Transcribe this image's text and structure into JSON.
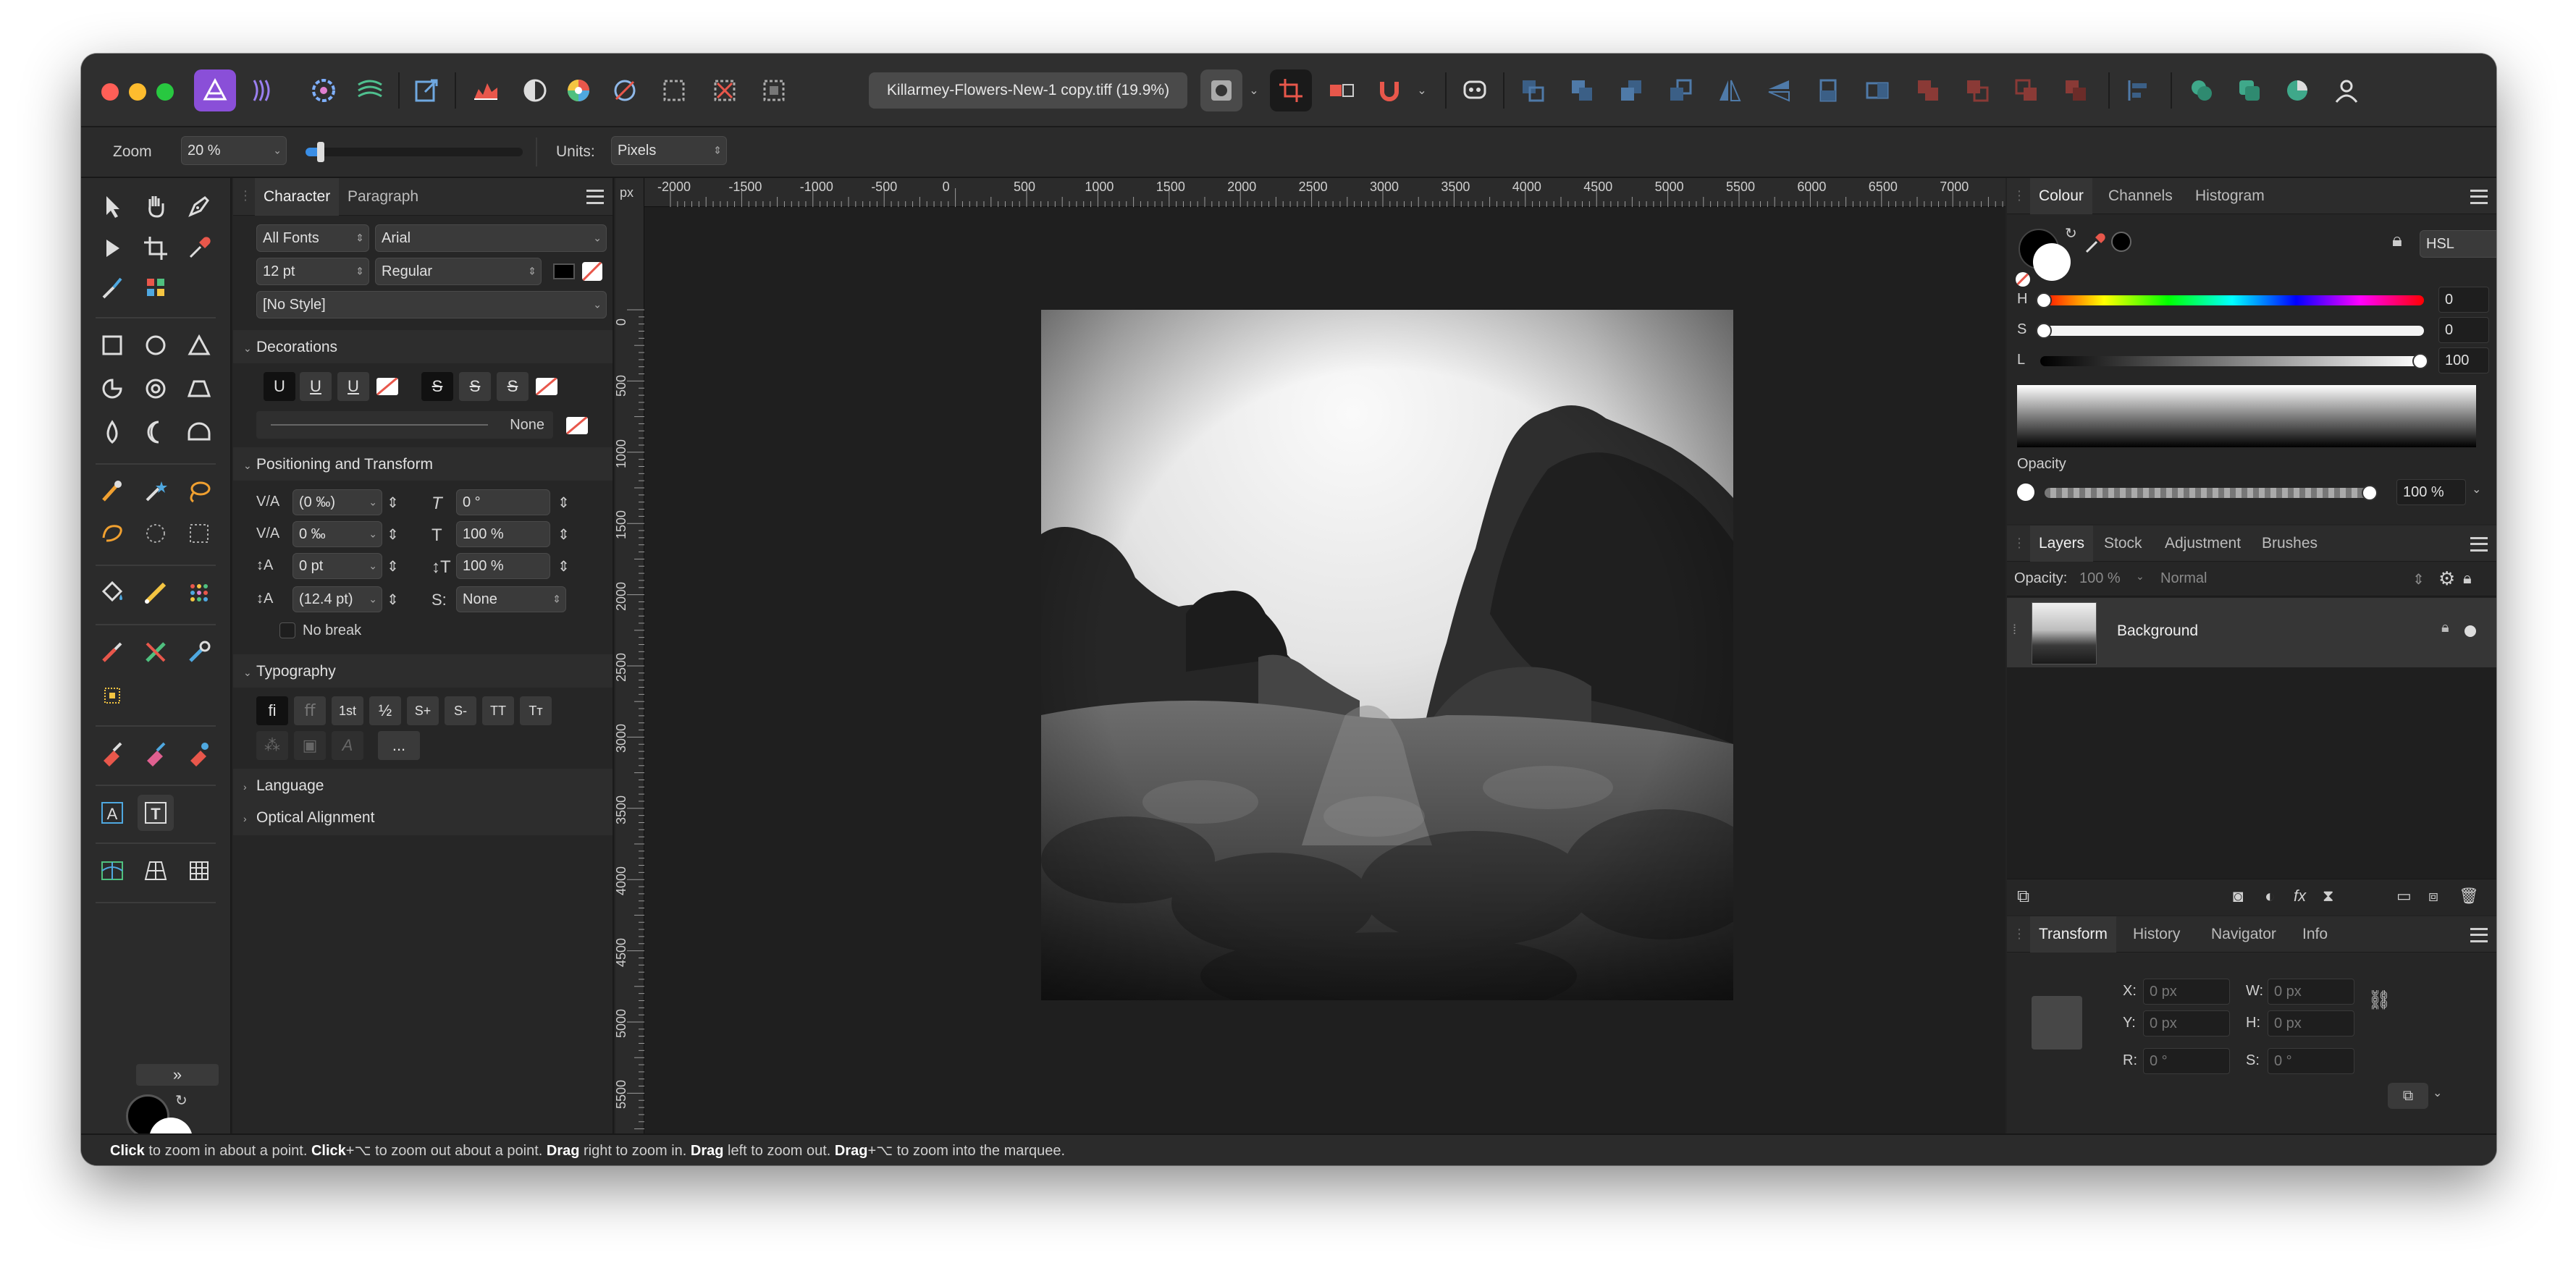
{
  "document": {
    "title": "Killarmey-Flowers-New-1 copy.tiff (19.9%)"
  },
  "context_toolbar": {
    "zoom_label": "Zoom",
    "zoom_value": "20 %",
    "units_label": "Units:",
    "units_value": "Pixels"
  },
  "character_panel": {
    "tabs": [
      "Character",
      "Paragraph"
    ],
    "font_collection": "All Fonts",
    "font_family": "Arial",
    "font_size": "12 pt",
    "font_style": "Regular",
    "paragraph_style": "[No Style]",
    "sections": {
      "decorations": "Decorations",
      "positioning": "Positioning and Transform",
      "typography": "Typography",
      "language": "Language",
      "optical": "Optical Alignment"
    },
    "decorations_line_value": "None",
    "positioning": {
      "kerning": "(0 ‰)",
      "tracking": "0 ‰",
      "baseline": "0 pt",
      "leading": "(12.4 pt)",
      "shear": "0 °",
      "horizontal_scale": "100 %",
      "vertical_scale": "100 %",
      "case": "None",
      "no_break": "No break"
    },
    "typography_buttons": [
      "fi",
      "ﬀ",
      "1st",
      "½",
      "S+",
      "S-",
      "TT",
      "Tт"
    ],
    "more_button": "..."
  },
  "ruler": {
    "unit": "px",
    "h_labels": [
      "-2000",
      "-1500",
      "-1000",
      "-500",
      "0",
      "500",
      "1000",
      "1500",
      "2000",
      "2500",
      "3000",
      "3500",
      "4000",
      "4500",
      "5000",
      "5500",
      "6000",
      "6500",
      "7000"
    ],
    "v_labels": [
      "0",
      "500",
      "1000",
      "1500",
      "2000",
      "2500",
      "3000",
      "3500",
      "4000",
      "4500",
      "5000",
      "5500"
    ]
  },
  "colour_panel": {
    "tabs": [
      "Colour",
      "Channels",
      "Histogram"
    ],
    "model": "HSL",
    "h_label": "H",
    "h_value": "0",
    "s_label": "S",
    "s_value": "0",
    "l_label": "L",
    "l_value": "100",
    "opacity_label": "Opacity",
    "opacity_value": "100 %"
  },
  "layers_panel": {
    "tabs": [
      "Layers",
      "Stock",
      "Adjustment",
      "Brushes"
    ],
    "opacity_label": "Opacity:",
    "opacity_value": "100 %",
    "blend_mode": "Normal",
    "layers": [
      {
        "name": "Background"
      }
    ]
  },
  "transform_panel": {
    "tabs": [
      "Transform",
      "History",
      "Navigator",
      "Info"
    ],
    "x_label": "X:",
    "x_value": "0 px",
    "y_label": "Y:",
    "y_value": "0 px",
    "w_label": "W:",
    "w_value": "0 px",
    "h_label": "H:",
    "h_value": "0 px",
    "r_label": "R:",
    "r_value": "0 °",
    "s_label": "S:",
    "s_value": "0 °"
  },
  "status_bar": {
    "parts": [
      {
        "b": "Click",
        "t": " to zoom in about a point. "
      },
      {
        "b": "Click",
        "t": "+⌥ to zoom out about a point. "
      },
      {
        "b": "Drag",
        "t": " right to zoom in. "
      },
      {
        "b": "Drag",
        "t": " left to zoom out. "
      },
      {
        "b": "Drag",
        "t": "+⌥ to zoom into the marquee."
      }
    ]
  },
  "colors": {
    "window_bg": "#232323",
    "panel_bg": "#262626",
    "accent": "#3a8ee6",
    "close": "#ff5f57",
    "minimize": "#febc2e",
    "zoom": "#28c840"
  }
}
